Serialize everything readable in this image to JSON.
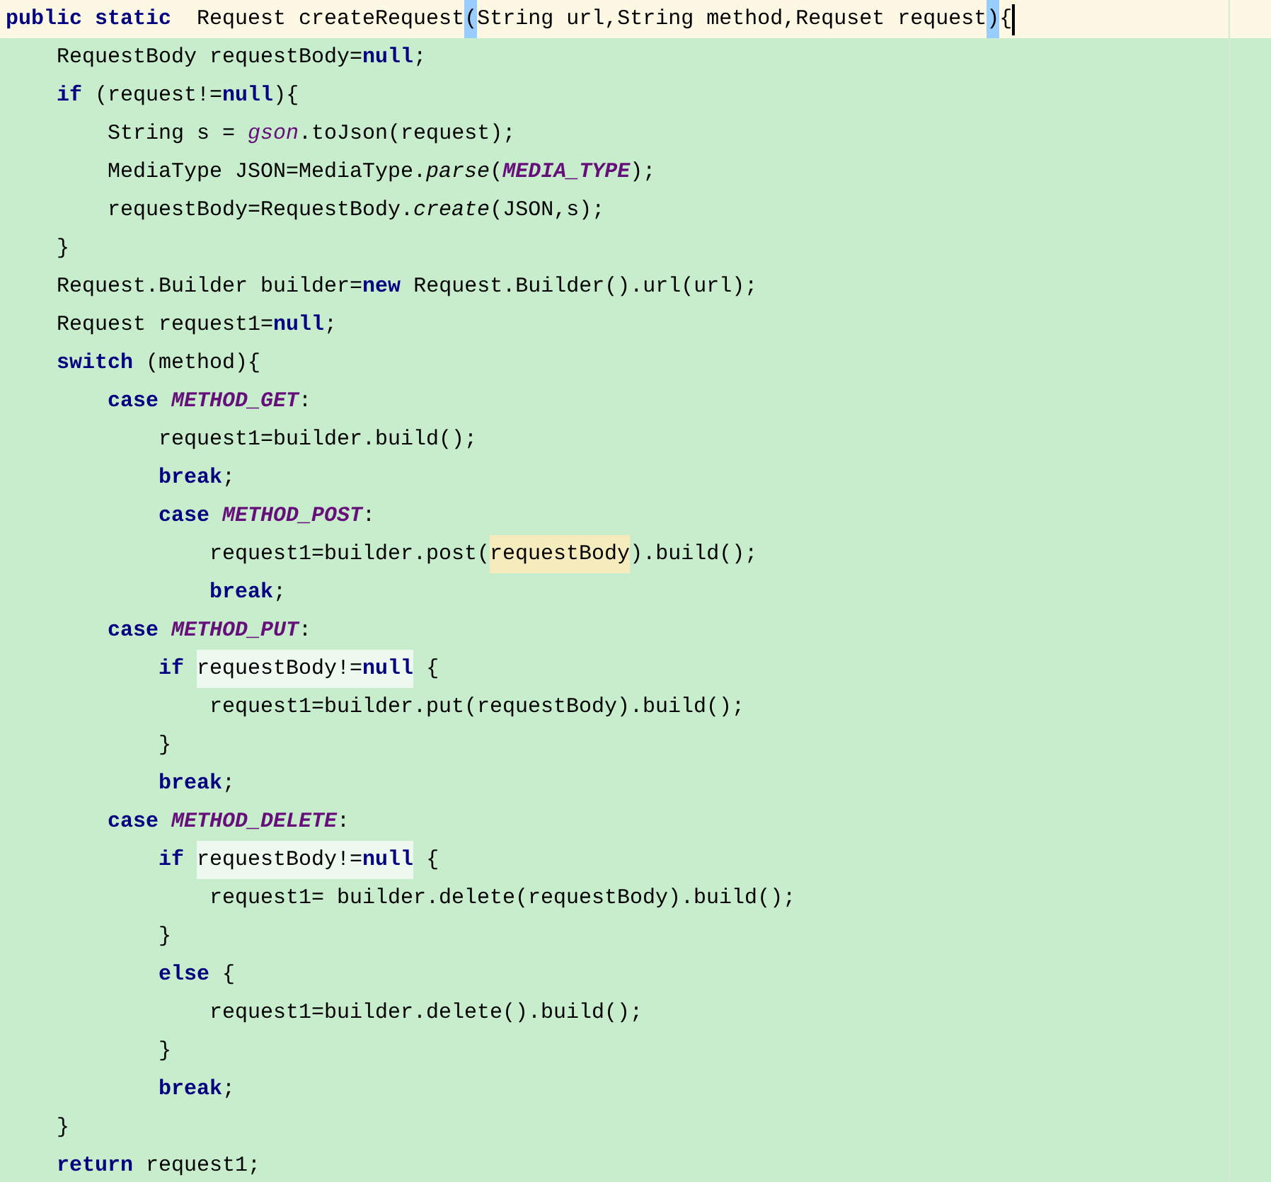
{
  "editor": {
    "lines": [
      {
        "current": true,
        "tokens": [
          {
            "text": "public static",
            "kind": "keyword"
          },
          {
            "text": "  Request createRequest",
            "kind": "plain"
          },
          {
            "text": "(",
            "kind": "match"
          },
          {
            "text": "String url,String method,Requset request",
            "kind": "plain"
          },
          {
            "text": ")",
            "kind": "match"
          },
          {
            "text": "{",
            "kind": "plain"
          }
        ],
        "children": [
          {
            "current": false,
            "tokens": [
              {
                "text": "RequestBody requestBody=",
                "kind": "plain"
              },
              {
                "text": "null",
                "kind": "keyword"
              },
              {
                "text": ";",
                "kind": "plain"
              }
            ]
          },
          {
            "current": false,
            "tokens": [
              {
                "text": "if",
                "kind": "keyword"
              },
              {
                "text": " (request!=",
                "kind": "plain"
              },
              {
                "text": "null",
                "kind": "keyword"
              },
              {
                "text": "){",
                "kind": "plain"
              }
            ],
            "children": [
              {
                "current": false,
                "tokens": [
                  {
                    "text": "String s = ",
                    "kind": "plain"
                  },
                  {
                    "text": "gson",
                    "kind": "field"
                  },
                  {
                    "text": ".toJson(request);",
                    "kind": "plain"
                  }
                ]
              },
              {
                "current": false,
                "tokens": [
                  {
                    "text": "MediaType JSON=MediaType.",
                    "kind": "plain"
                  },
                  {
                    "text": "parse",
                    "kind": "method"
                  },
                  {
                    "text": "(",
                    "kind": "plain"
                  },
                  {
                    "text": "MEDIA_TYPE",
                    "kind": "constant"
                  },
                  {
                    "text": ");",
                    "kind": "plain"
                  }
                ]
              },
              {
                "current": false,
                "tokens": [
                  {
                    "text": "requestBody=RequestBody.",
                    "kind": "plain"
                  },
                  {
                    "text": "create",
                    "kind": "method"
                  },
                  {
                    "text": "(JSON,s);",
                    "kind": "plain"
                  }
                ]
              }
            ]
          },
          {
            "current": false,
            "tokens": [
              {
                "text": "}",
                "kind": "plain"
              }
            ]
          },
          {
            "current": false,
            "tokens": [
              {
                "text": "Request.Builder builder=",
                "kind": "plain"
              },
              {
                "text": "new",
                "kind": "keyword"
              },
              {
                "text": " Request.Builder().url(url);",
                "kind": "plain"
              }
            ]
          },
          {
            "current": false,
            "tokens": [
              {
                "text": "Request request1=",
                "kind": "plain"
              },
              {
                "text": "null",
                "kind": "keyword"
              },
              {
                "text": ";",
                "kind": "plain"
              }
            ]
          },
          {
            "current": false,
            "tokens": [
              {
                "text": "switch",
                "kind": "keyword"
              },
              {
                "text": " (method){",
                "kind": "plain"
              }
            ],
            "children": [
              {
                "current": false,
                "tokens": [
                  {
                    "text": "case ",
                    "kind": "keyword"
                  },
                  {
                    "text": "METHOD_GET",
                    "kind": "constant"
                  },
                  {
                    "text": ":",
                    "kind": "plain"
                  }
                ],
                "children": [
                  {
                    "current": false,
                    "tokens": [
                      {
                        "text": "request1=builder.build();",
                        "kind": "plain"
                      }
                    ]
                  },
                  {
                    "current": false,
                    "tokens": [
                      {
                        "text": "break",
                        "kind": "keyword"
                      },
                      {
                        "text": ";",
                        "kind": "plain"
                      }
                    ]
                  },
                  {
                    "current": false,
                    "tokens": [
                      {
                        "text": "case ",
                        "kind": "keyword"
                      },
                      {
                        "text": "METHOD_POST",
                        "kind": "constant"
                      },
                      {
                        "text": ":",
                        "kind": "plain"
                      }
                    ],
                    "children": [
                      {
                        "current": false,
                        "tokens": [
                          {
                            "text": "request1=builder.post(",
                            "kind": "plain"
                          },
                          {
                            "text": "requestBody",
                            "kind": "usage"
                          },
                          {
                            "text": ").build();",
                            "kind": "plain"
                          }
                        ]
                      },
                      {
                        "current": false,
                        "tokens": [
                          {
                            "text": "break",
                            "kind": "keyword"
                          },
                          {
                            "text": ";",
                            "kind": "plain"
                          }
                        ]
                      }
                    ]
                  }
                ]
              },
              {
                "current": false,
                "tokens": [
                  {
                    "text": "case ",
                    "kind": "keyword"
                  },
                  {
                    "text": "METHOD_PUT",
                    "kind": "constant"
                  },
                  {
                    "text": ":",
                    "kind": "plain"
                  }
                ],
                "children": [
                  {
                    "current": false,
                    "tokens": [
                      {
                        "text": "if ",
                        "kind": "keyword"
                      },
                      {
                        "text": "requestBody!=",
                        "kind": "hint"
                      },
                      {
                        "text": "null",
                        "kind": "hintkeyword"
                      },
                      {
                        "text": " {",
                        "kind": "plain"
                      }
                    ],
                    "children": [
                      {
                        "current": false,
                        "tokens": [
                          {
                            "text": "request1=builder.put(requestBody).build();",
                            "kind": "plain"
                          }
                        ]
                      }
                    ]
                  },
                  {
                    "current": false,
                    "tokens": [
                      {
                        "text": "}",
                        "kind": "plain"
                      }
                    ]
                  },
                  {
                    "current": false,
                    "tokens": [
                      {
                        "text": "break",
                        "kind": "keyword"
                      },
                      {
                        "text": ";",
                        "kind": "plain"
                      }
                    ]
                  }
                ]
              },
              {
                "current": false,
                "tokens": [
                  {
                    "text": "case ",
                    "kind": "keyword"
                  },
                  {
                    "text": "METHOD_DELETE",
                    "kind": "constant"
                  },
                  {
                    "text": ":",
                    "kind": "plain"
                  }
                ],
                "children": [
                  {
                    "current": false,
                    "tokens": [
                      {
                        "text": "if ",
                        "kind": "keyword"
                      },
                      {
                        "text": "requestBody!=",
                        "kind": "hint"
                      },
                      {
                        "text": "null",
                        "kind": "hintkeyword"
                      },
                      {
                        "text": " {",
                        "kind": "plain"
                      }
                    ],
                    "children": [
                      {
                        "current": false,
                        "tokens": [
                          {
                            "text": "request1= builder.delete(requestBody).build();",
                            "kind": "plain"
                          }
                        ]
                      }
                    ]
                  },
                  {
                    "current": false,
                    "tokens": [
                      {
                        "text": "}",
                        "kind": "plain"
                      }
                    ]
                  },
                  {
                    "current": false,
                    "tokens": [
                      {
                        "text": "else",
                        "kind": "keyword"
                      },
                      {
                        "text": " {",
                        "kind": "plain"
                      }
                    ],
                    "children": [
                      {
                        "current": false,
                        "tokens": [
                          {
                            "text": "request1=builder.delete().build();",
                            "kind": "plain"
                          }
                        ]
                      }
                    ]
                  },
                  {
                    "current": false,
                    "tokens": [
                      {
                        "text": "}",
                        "kind": "plain"
                      }
                    ]
                  },
                  {
                    "current": false,
                    "tokens": [
                      {
                        "text": "break",
                        "kind": "keyword"
                      },
                      {
                        "text": ";",
                        "kind": "plain"
                      }
                    ]
                  }
                ]
              }
            ]
          },
          {
            "current": false,
            "tokens": [
              {
                "text": "}",
                "kind": "plain"
              }
            ]
          },
          {
            "current": false,
            "tokens": [
              {
                "text": "return",
                "kind": "keyword"
              },
              {
                "text": " request1;",
                "kind": "plain"
              }
            ]
          }
        ]
      }
    ]
  }
}
